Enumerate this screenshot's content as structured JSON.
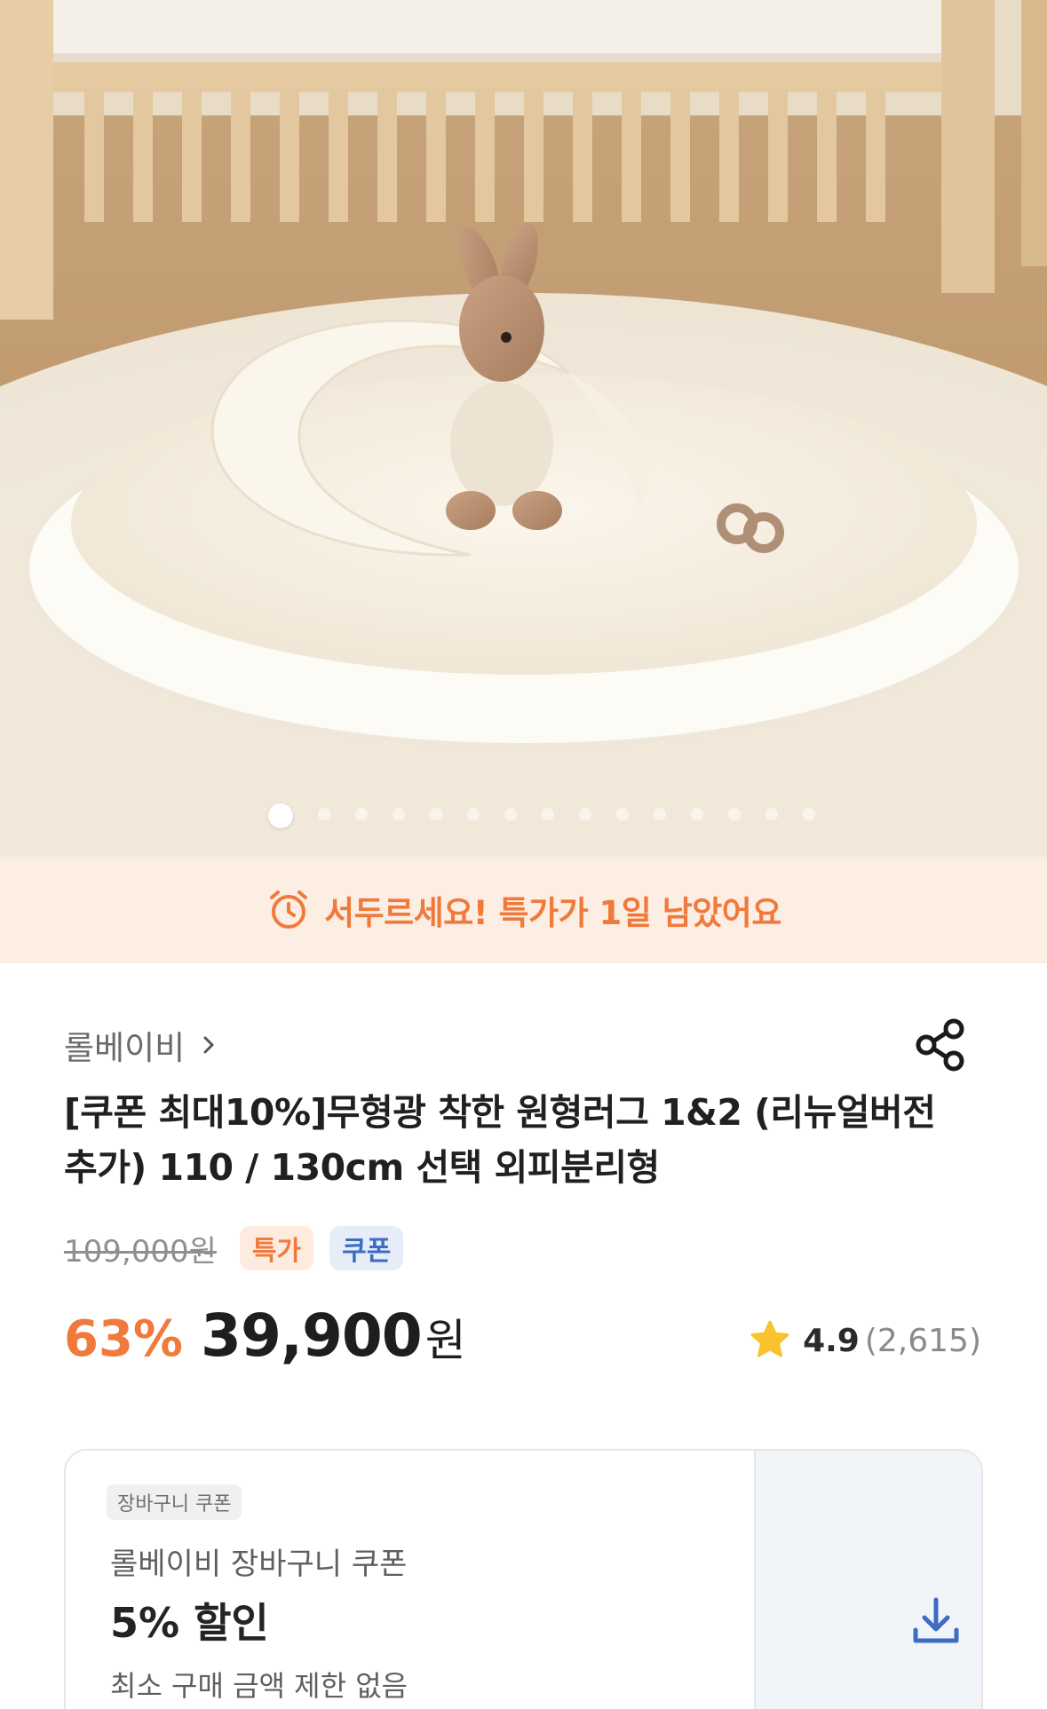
{
  "carousel": {
    "total_images": 15,
    "active_index": 0
  },
  "deal_banner": {
    "icon": "alarm-clock-icon",
    "text": "서두르세요! 특가가 1일 남았어요",
    "color": "#ef7a3b",
    "background": "#fdeee4"
  },
  "product": {
    "brand": "롤베이비",
    "brand_chevron": "chevron-right-icon",
    "share_icon": "share-icon",
    "title": "[쿠폰 최대10%]무형광 착한 원형러그 1&2 (리뉴얼버전 추가) 110 / 130cm 선택 외피분리형",
    "original_price": "109,000원",
    "badges": [
      "특가",
      "쿠폰"
    ],
    "discount_rate": "63%",
    "price": "39,900",
    "price_unit": "원",
    "rating": "4.9",
    "review_count": "(2,615)",
    "accent_color": "#ef7a3b"
  },
  "coupon": {
    "tag": "장바구니 쿠폰",
    "name": "롤베이비 장바구니 쿠폰",
    "discount": "5% 할인",
    "condition": "최소 구매 금액 제한 없음",
    "download_icon": "download-icon"
  }
}
